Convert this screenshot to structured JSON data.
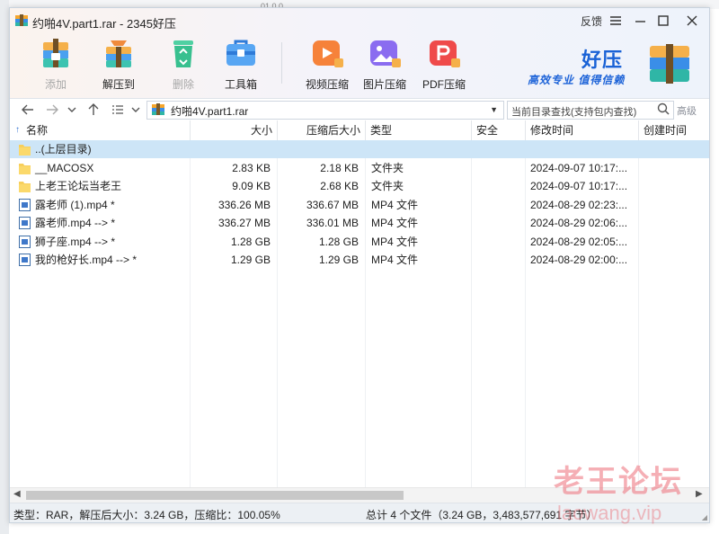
{
  "window": {
    "title": "约啪4V.part1.rar - 2345好压",
    "feedback_label": "反馈"
  },
  "toolbar": {
    "items": [
      {
        "label": "添加",
        "icon": "add-archive-icon",
        "enabled": false
      },
      {
        "label": "解压到",
        "icon": "extract-icon",
        "enabled": true
      },
      {
        "label": "删除",
        "icon": "recycle-delete-icon",
        "enabled": false
      },
      {
        "label": "工具箱",
        "icon": "toolbox-icon",
        "enabled": true
      },
      {
        "label": "视频压缩",
        "icon": "video-compress-icon",
        "enabled": true
      },
      {
        "label": "图片压缩",
        "icon": "image-compress-icon",
        "enabled": true
      },
      {
        "label": "PDF压缩",
        "icon": "pdf-compress-icon",
        "enabled": true
      }
    ]
  },
  "brand": {
    "name": "好压",
    "slogan": "高效专业 值得信赖"
  },
  "navigation": {
    "path": "约啪4V.part1.rar",
    "search_placeholder": "当前目录查找(支持包内查找)",
    "advanced_label": "高级"
  },
  "columns": [
    "名称",
    "大小",
    "压缩后大小",
    "类型",
    "安全",
    "修改时间",
    "创建时间"
  ],
  "sort_indicator": "↑",
  "files": [
    {
      "name": "..(上层目录)",
      "size": "",
      "packed": "",
      "type": "",
      "security": "",
      "modified": "",
      "created": "",
      "icon": "folder",
      "selected": true
    },
    {
      "name": "__MACOSX",
      "size": "2.83 KB",
      "packed": "2.18 KB",
      "type": "文件夹",
      "security": "",
      "modified": "2024-09-07 10:17:...",
      "created": "",
      "icon": "folder",
      "selected": false
    },
    {
      "name": "上老王论坛当老王",
      "size": "9.09 KB",
      "packed": "2.68 KB",
      "type": "文件夹",
      "security": "",
      "modified": "2024-09-07 10:17:...",
      "created": "",
      "icon": "folder",
      "selected": false
    },
    {
      "name": "露老师 (1).mp4 *",
      "size": "336.26 MB",
      "packed": "336.67 MB",
      "type": "MP4 文件",
      "security": "",
      "modified": "2024-08-29 02:23:...",
      "created": "",
      "icon": "file",
      "selected": false
    },
    {
      "name": "露老师.mp4 --> *",
      "size": "336.27 MB",
      "packed": "336.01 MB",
      "type": "MP4 文件",
      "security": "",
      "modified": "2024-08-29 02:06:...",
      "created": "",
      "icon": "file",
      "selected": false
    },
    {
      "name": "狮子座.mp4 --> *",
      "size": "1.28 GB",
      "packed": "1.28 GB",
      "type": "MP4 文件",
      "security": "",
      "modified": "2024-08-29 02:05:...",
      "created": "",
      "icon": "file",
      "selected": false
    },
    {
      "name": "我的枪好长.mp4 --> *",
      "size": "1.29 GB",
      "packed": "1.29 GB",
      "type": "MP4 文件",
      "security": "",
      "modified": "2024-08-29 02:00:...",
      "created": "",
      "icon": "file",
      "selected": false
    }
  ],
  "status": {
    "left": "类型：RAR，解压后大小：3.24 GB，压缩比：100.05%",
    "right": "总计 4 个文件（3.24 GB，3,483,577,691 字节）"
  },
  "watermark": {
    "text": "老王论坛",
    "url": "laowang.vip"
  },
  "background_fragment": "01.0.0"
}
